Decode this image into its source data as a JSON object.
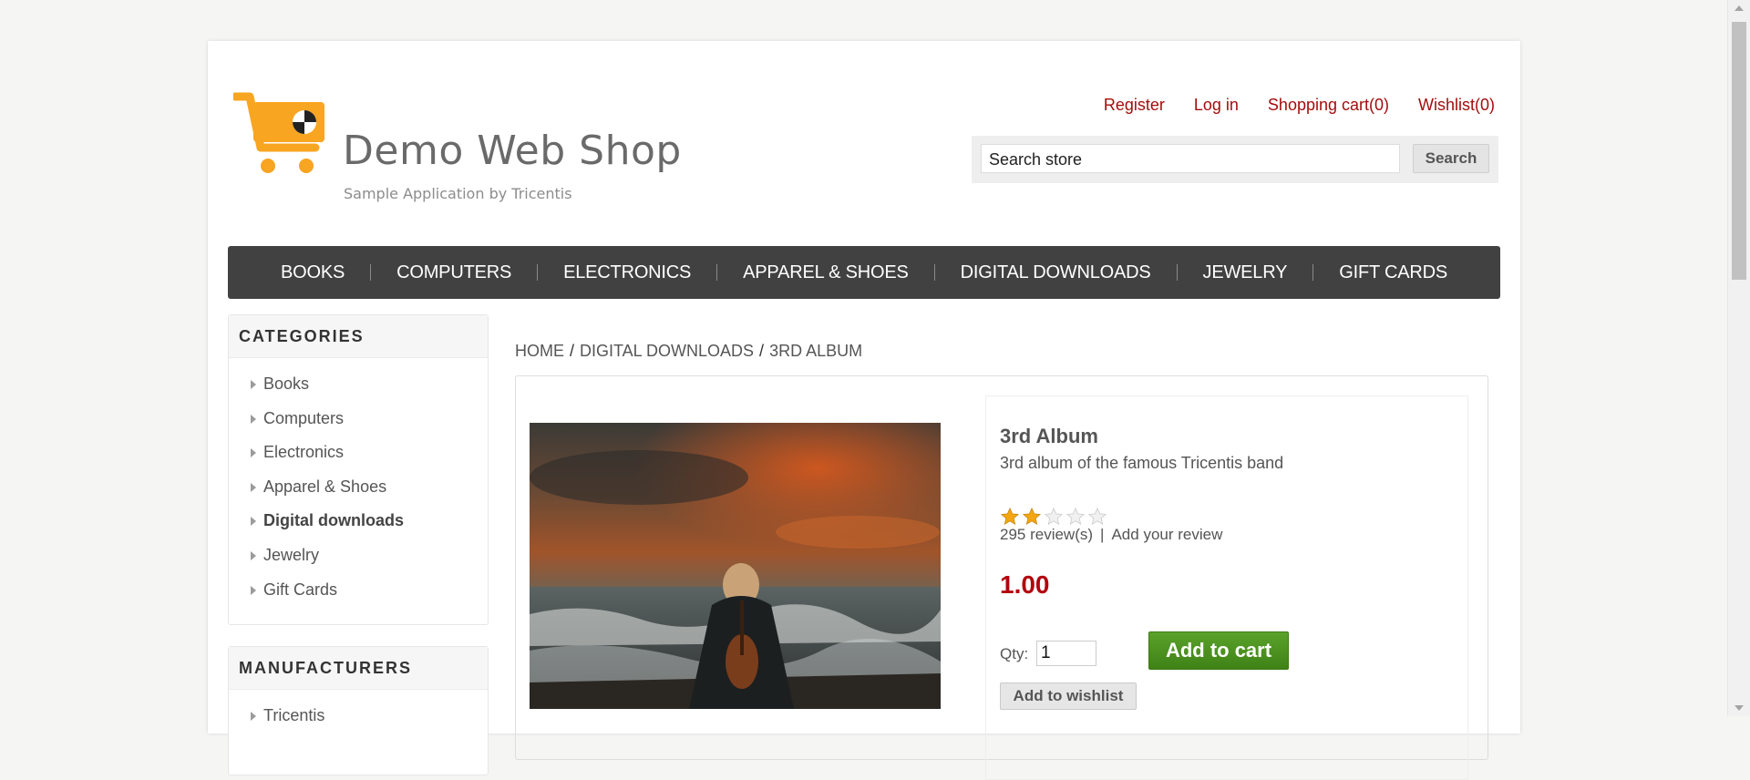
{
  "header": {
    "title": "Demo Web Shop",
    "subtitle": "Sample Application by Tricentis",
    "links": {
      "register": "Register",
      "login": "Log in",
      "cart": "Shopping cart(0)",
      "wishlist": "Wishlist(0)"
    },
    "search": {
      "value": "Search store",
      "button": "Search"
    }
  },
  "menu": {
    "items": [
      "BOOKS",
      "COMPUTERS",
      "ELECTRONICS",
      "APPAREL & SHOES",
      "DIGITAL DOWNLOADS",
      "JEWELRY",
      "GIFT CARDS"
    ]
  },
  "sidebar": {
    "categories_title": "CATEGORIES",
    "categories": [
      "Books",
      "Computers",
      "Electronics",
      "Apparel & Shoes",
      "Digital downloads",
      "Jewelry",
      "Gift Cards"
    ],
    "active_category": "Digital downloads",
    "manufacturers_title": "MANUFACTURERS",
    "manufacturers": [
      "Tricentis"
    ]
  },
  "breadcrumb": {
    "home": "HOME",
    "category": "DIGITAL DOWNLOADS",
    "current": "3RD ALBUM"
  },
  "product": {
    "name": "3rd Album",
    "short_description": "3rd album of the famous Tricentis band",
    "rating": 2,
    "rating_max": 5,
    "reviews_link": "295 review(s)",
    "add_review_link": "Add your review",
    "price": "1.00",
    "qty_label": "Qty:",
    "qty_value": "1",
    "add_to_cart": "Add to cart",
    "add_to_wishlist": "Add to wishlist"
  },
  "colors": {
    "link_red": "#a40d0d",
    "menu_bg": "#414141",
    "price_red": "#b1040e",
    "add_cart_green": "#4a8f20",
    "logo_orange": "#f8a521"
  }
}
